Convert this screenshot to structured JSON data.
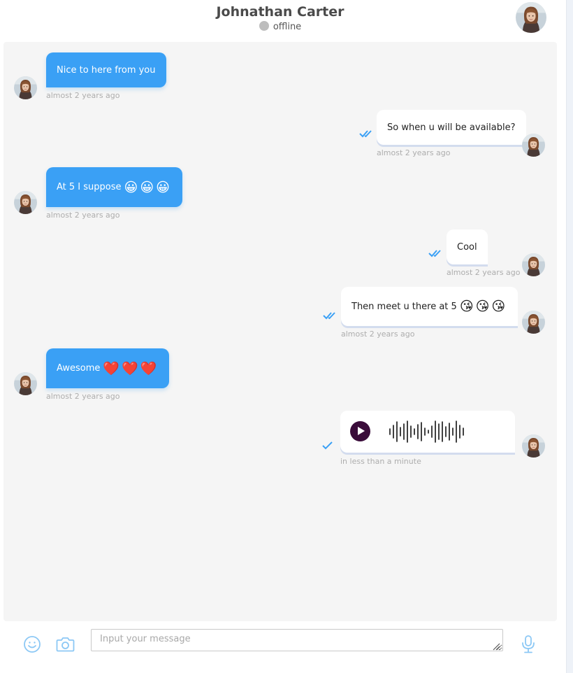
{
  "header": {
    "name": "Johnathan Carter",
    "status": "offline"
  },
  "messages": [
    {
      "direction": "incoming",
      "text": "Nice to here from you",
      "emoji": "",
      "time": "almost 2 years ago"
    },
    {
      "direction": "outgoing",
      "text": "So when u will be available?",
      "emoji": "",
      "time": "almost 2 years ago",
      "receipt": "read"
    },
    {
      "direction": "incoming",
      "text": "At 5 I suppose",
      "emoji": "😀😀😀",
      "time": "almost 2 years ago"
    },
    {
      "direction": "outgoing",
      "text": "Cool",
      "emoji": "",
      "time": "almost 2 years ago",
      "receipt": "read"
    },
    {
      "direction": "outgoing",
      "text": "Then meet u there at 5",
      "emoji": "😘😘😘",
      "time": "almost 2 years ago",
      "receipt": "read"
    },
    {
      "direction": "incoming",
      "text": "Awesome",
      "emoji": "❤️❤️❤️",
      "time": "almost 2 years ago"
    },
    {
      "direction": "outgoing",
      "type": "voice",
      "time": "in less than a minute",
      "receipt": "sent"
    }
  ],
  "composer": {
    "placeholder": "Input your message",
    "value": ""
  },
  "icons": {
    "emoji": "smiley-icon",
    "camera": "camera-icon",
    "mic": "microphone-icon",
    "read": "double-check-icon",
    "sent": "single-check-icon",
    "play": "play-icon"
  },
  "colors": {
    "incoming_bubble": "#3aa0f5",
    "outgoing_bubble": "#ffffff",
    "receipt": "#3aa0f5",
    "icon": "#8cc8f5",
    "status_dot": "#bdbdbd",
    "play_button": "#3a0c3a"
  }
}
